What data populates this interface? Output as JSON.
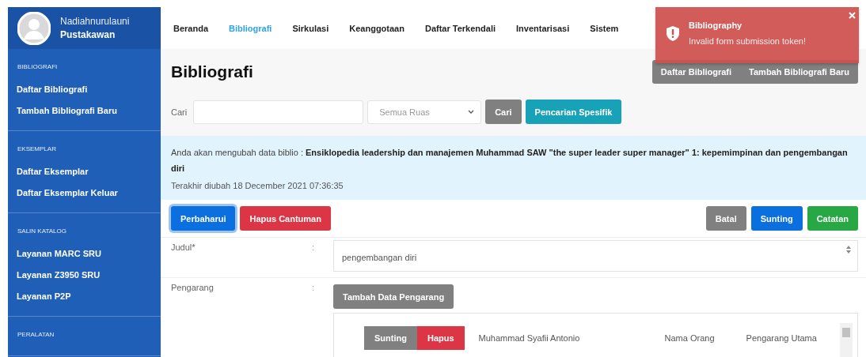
{
  "user": {
    "name": "Nadiahnurulauni",
    "role": "Pustakawan"
  },
  "sidebar": {
    "sections": [
      {
        "heading": "BIBLIOGRAFI",
        "items": [
          {
            "label": "Daftar Bibliografi"
          },
          {
            "label": "Tambah Bibliografi Baru"
          }
        ]
      },
      {
        "heading": "EKSEMPLAR",
        "items": [
          {
            "label": "Daftar Eksemplar"
          },
          {
            "label": "Daftar Eksemplar Keluar"
          }
        ]
      },
      {
        "heading": "SALIN KATALOG",
        "items": [
          {
            "label": "Layanan MARC SRU"
          },
          {
            "label": "Layanan Z3950 SRU"
          },
          {
            "label": "Layanan P2P"
          }
        ]
      },
      {
        "heading": "PERALATAN"
      }
    ]
  },
  "nav": [
    {
      "label": "Beranda",
      "selected": false
    },
    {
      "label": "Bibliografi",
      "selected": true
    },
    {
      "label": "Sirkulasi",
      "selected": false
    },
    {
      "label": "Keanggotaan",
      "selected": false
    },
    {
      "label": "Daftar Terkendali",
      "selected": false
    },
    {
      "label": "Inventarisasi",
      "selected": false
    },
    {
      "label": "Sistem",
      "selected": false
    }
  ],
  "toast": {
    "title": "Bibliography",
    "message": "Invalid form submission token!"
  },
  "page": {
    "title": "Bibliografi",
    "header_buttons": [
      "Daftar Bibliografi",
      "Tambah Bibliografi Baru"
    ]
  },
  "search": {
    "label": "Cari",
    "select": "Semua Ruas",
    "buttons": [
      {
        "label": "Cari",
        "kind": "secondary"
      },
      {
        "label": "Pencarian Spesifik",
        "kind": "info"
      }
    ]
  },
  "notice": {
    "text": "Anda akan mengubah data biblio : **Ensiklopedia leadership dan manajemen Muhammad SAW \"the super leader super manager\" 1: kepemimpinan dan pengembangan diri**",
    "updated": "Terakhir diubah 18 December 2021 07:36:35"
  },
  "actions": {
    "left": [
      {
        "label": "Perbaharui",
        "kind": "primary",
        "focused": true
      },
      {
        "label": "Hapus Cantuman",
        "kind": "danger",
        "focused": false
      }
    ],
    "right": [
      {
        "label": "Batal",
        "kind": "secondary",
        "focused": false
      },
      {
        "label": "Sunting",
        "kind": "primary",
        "focused": false
      },
      {
        "label": "Catatan",
        "kind": "success",
        "focused": false
      }
    ]
  },
  "form": {
    "fields": [
      {
        "kind": "textarea",
        "label": "Judul*",
        "colon": ":",
        "value": "pengembangan diri"
      },
      {
        "kind": "authors",
        "label": "Pengarang",
        "colon": ":",
        "button": "Tambah Data Pengarang",
        "authors": [
          {
            "edit": "Sunting",
            "remove": "Hapus",
            "name": "Muhammad Syafii Antonio",
            "type": "Nama Orang",
            "role": "Pengarang Utama"
          }
        ]
      }
    ]
  }
}
